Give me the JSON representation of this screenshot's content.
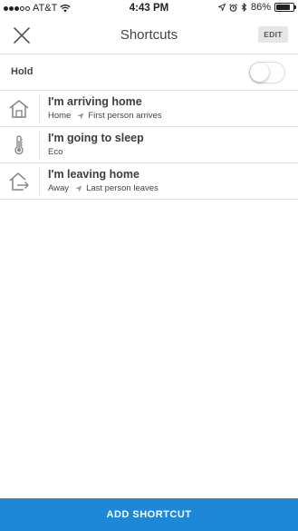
{
  "status": {
    "carrier": "AT&T",
    "time": "4:43 PM",
    "battery": "86%",
    "battery_level": 0.86
  },
  "header": {
    "title": "Shortcuts",
    "edit_label": "EDIT"
  },
  "hold": {
    "label": "Hold",
    "enabled": false
  },
  "shortcuts": [
    {
      "title": "I'm arriving home",
      "mode": "Home",
      "trigger": "First person arrives",
      "icon": "home-icon"
    },
    {
      "title": "I'm going to sleep",
      "mode": "Eco",
      "trigger": "",
      "icon": "thermometer-icon"
    },
    {
      "title": "I'm leaving home",
      "mode": "Away",
      "trigger": "Last person leaves",
      "icon": "leave-home-icon"
    }
  ],
  "footer": {
    "add_label": "ADD SHORTCUT"
  },
  "colors": {
    "accent": "#1e88d8",
    "divider": "#e3e3e3",
    "edit_bg": "#e6e6e6"
  }
}
